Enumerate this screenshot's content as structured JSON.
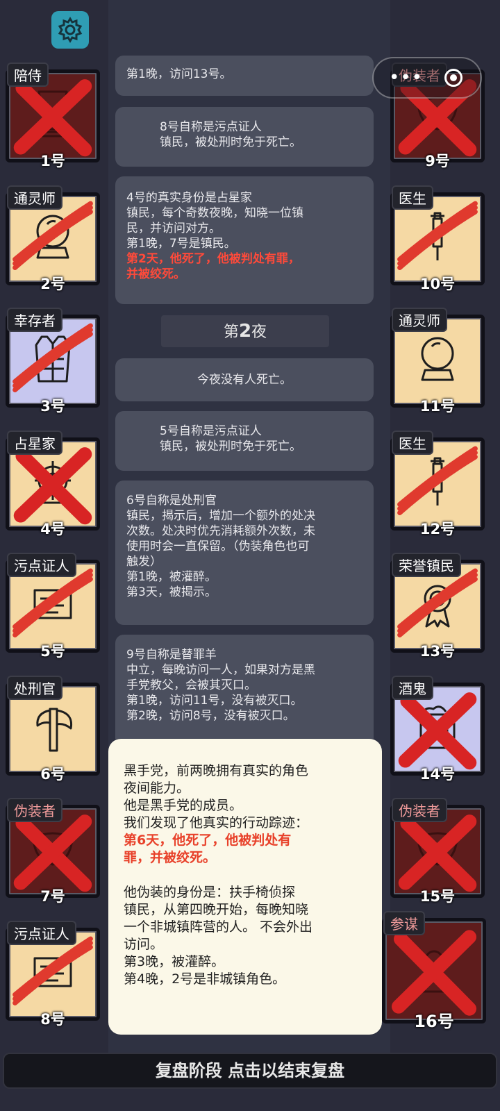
{
  "players": [
    {
      "id": "p1",
      "role": "陪侍",
      "num": "1号",
      "bg": "red",
      "mark": "x",
      "pink": false,
      "icon": "goblet-icon"
    },
    {
      "id": "p2",
      "role": "通灵师",
      "num": "2号",
      "bg": "tan",
      "mark": "claw",
      "pink": false,
      "icon": "crystal-ball-icon"
    },
    {
      "id": "p3",
      "role": "幸存者",
      "num": "3号",
      "bg": "lav",
      "mark": "claw",
      "pink": false,
      "icon": "vest-icon"
    },
    {
      "id": "p4",
      "role": "占星家",
      "num": "4号",
      "bg": "tan",
      "mark": "x",
      "pink": false,
      "icon": "astrolabe-icon"
    },
    {
      "id": "p5",
      "role": "污点证人",
      "num": "5号",
      "bg": "tan",
      "mark": "claw",
      "pink": false,
      "icon": "scroll-icon"
    },
    {
      "id": "p6",
      "role": "处刑官",
      "num": "6号",
      "bg": "tan",
      "mark": "none",
      "pink": false,
      "icon": "axe-icon"
    },
    {
      "id": "p7",
      "role": "伪装者",
      "num": "7号",
      "bg": "red",
      "mark": "x",
      "pink": true,
      "icon": "mask-icon"
    },
    {
      "id": "p8",
      "role": "污点证人",
      "num": "8号",
      "bg": "tan",
      "mark": "claw",
      "pink": false,
      "icon": "scroll-icon"
    },
    {
      "id": "p9",
      "role": "伪装者",
      "num": "9号",
      "bg": "red",
      "mark": "x",
      "pink": true,
      "icon": "mask-icon"
    },
    {
      "id": "p10",
      "role": "医生",
      "num": "10号",
      "bg": "tan",
      "mark": "claw",
      "pink": false,
      "icon": "syringe-icon"
    },
    {
      "id": "p11",
      "role": "通灵师",
      "num": "11号",
      "bg": "tan",
      "mark": "none",
      "pink": false,
      "icon": "crystal-ball-icon"
    },
    {
      "id": "p12",
      "role": "医生",
      "num": "12号",
      "bg": "tan",
      "mark": "claw",
      "pink": false,
      "icon": "syringe-icon"
    },
    {
      "id": "p13",
      "role": "荣誉镇民",
      "num": "13号",
      "bg": "tan",
      "mark": "claw",
      "pink": false,
      "icon": "medal-icon"
    },
    {
      "id": "p14",
      "role": "酒鬼",
      "num": "14号",
      "bg": "lav",
      "mark": "x",
      "pink": false,
      "icon": "beer-mug-icon"
    },
    {
      "id": "p15",
      "role": "伪装者",
      "num": "15号",
      "bg": "red",
      "mark": "x",
      "pink": true,
      "icon": "mask-icon"
    },
    {
      "id": "p16",
      "role": "参谋",
      "num": "16号",
      "bg": "red",
      "mark": "x",
      "pink": true,
      "icon": "advisor-icon"
    }
  ],
  "log": {
    "b0": [
      "第1晚，访问13号。"
    ],
    "b1": [
      "8号自称是污点证人",
      "镇民，被处刑时免于死亡。"
    ],
    "b2": [
      "4号的真实身份是占星家",
      "镇民，每个奇数夜晚，知晓一位镇",
      "民，并访问对方。",
      "第1晚，7号是镇民。"
    ],
    "b2_red": [
      "第2天，他死了，他被判处有罪，",
      "并被绞死。"
    ],
    "night_prefix": "第",
    "night_num": "2",
    "night_suffix": "夜",
    "b3": [
      "今夜没有人死亡。"
    ],
    "b4": [
      "5号自称是污点证人",
      "镇民，被处刑时免于死亡。"
    ],
    "b5": [
      "6号自称是处刑官",
      "镇民，揭示后，增加一个额外的处决",
      "次数。处决时优先消耗额外次数，未",
      "使用时会一直保留。（伪装角色也可",
      "触发）",
      "第1晚，被灌醉。",
      "第3天，被揭示。"
    ],
    "b6": [
      "9号自称是替罪羊",
      "中立，每晚访问一人，如果对方是黑",
      "手党教父，会被其灭口。",
      "第1晚，访问11号，没有被灭口。",
      "第2晚，访问8号，没有被灭口。"
    ]
  },
  "popup": {
    "p1": [
      "黑手党，前两晚拥有真实的角色",
      "夜间能力。",
      "他是黑手党的成员。",
      "我们发现了他真实的行动踪迹："
    ],
    "red": [
      "第6天，他死了，他被判处有",
      "罪，并被绞死。"
    ],
    "p2": [
      "他伪装的身份是：扶手椅侦探",
      "镇民，从第四晚开始，每晚知晓",
      "一个非城镇阵营的人。 不会外出",
      "访问。",
      "第3晚，被灌醉。",
      "第4晚，2号是非城镇角色。"
    ]
  },
  "bottom_bar": "复盘阶段 点击以结束复盘",
  "colors": {
    "gear_bg": "#2f9db4",
    "dead_red": "#d82424",
    "claw_red": "#e03a2e",
    "highlight_red": "#ff4a3a"
  }
}
